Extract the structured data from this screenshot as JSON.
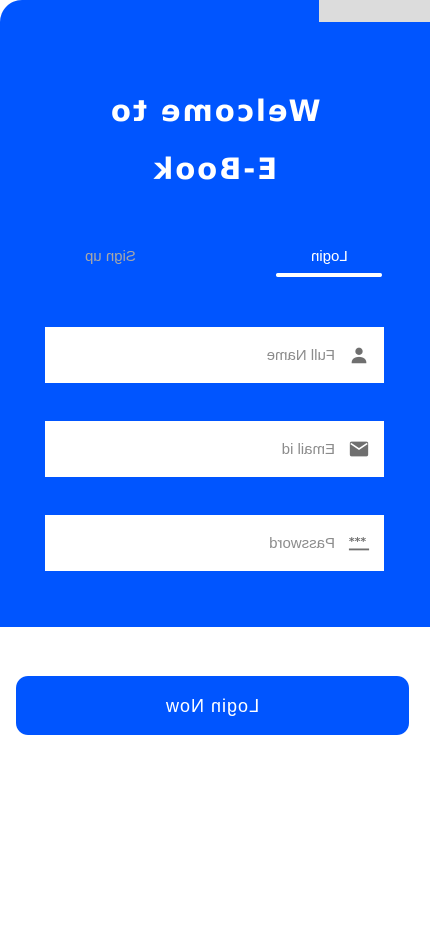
{
  "header": {
    "title_line1": "Welcome to",
    "title_line2": "E-Book"
  },
  "tabs": {
    "login": "Login",
    "signup": "Sign up",
    "active": "login"
  },
  "form": {
    "full_name": {
      "placeholder": "Full Name",
      "value": "",
      "icon": "person-icon"
    },
    "email": {
      "placeholder": "Email id",
      "value": "",
      "icon": "envelope-icon"
    },
    "password": {
      "placeholder": "Password",
      "value": "",
      "icon": "password-dots-icon"
    }
  },
  "actions": {
    "login_now": "Login Now"
  },
  "colors": {
    "primary": "#0055ff",
    "corner_tab": "#dcdcdc",
    "inactive_tab": "#a8a8a8",
    "icon": "#6f6f6f"
  }
}
